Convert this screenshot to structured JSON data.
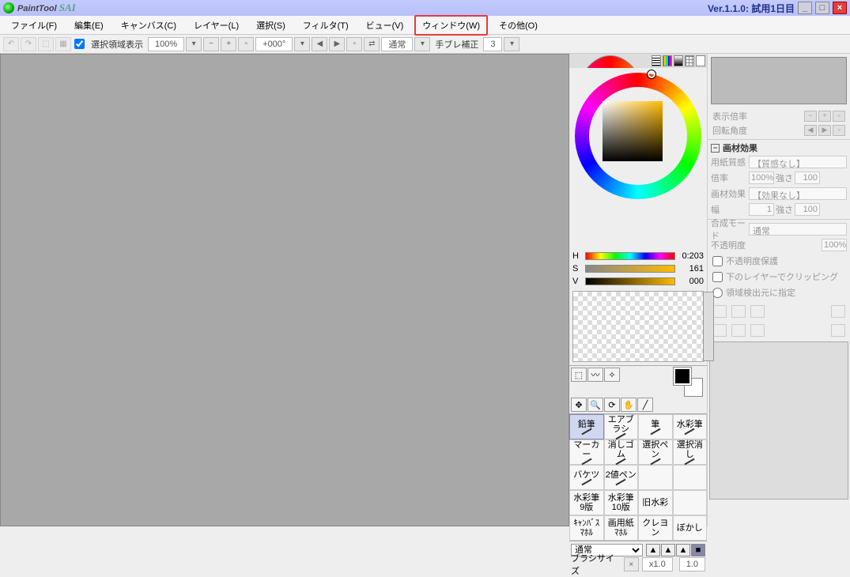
{
  "titlebar": {
    "app": "PaintTool",
    "sai": "SAI",
    "version": "Ver.1.1.0: 試用1日目"
  },
  "menu": {
    "file": "ファイル(F)",
    "edit": "編集(E)",
    "canvas": "キャンバス(C)",
    "layer": "レイヤー(L)",
    "select": "選択(S)",
    "filter": "フィルタ(T)",
    "view": "ビュー(V)",
    "window": "ウィンドウ(W)",
    "other": "その他(O)"
  },
  "toolbar": {
    "sel_show": "選択領域表示",
    "zoom": "100%",
    "angle": "+000°",
    "mode": "通常",
    "stabilizer_lbl": "手ブレ補正",
    "stabilizer_val": "3"
  },
  "hsv": {
    "h_lbl": "H",
    "h_val": "0:203",
    "s_lbl": "S",
    "s_val": "161",
    "v_lbl": "V",
    "v_val": "000"
  },
  "brushes": [
    "鉛筆",
    "エアブラシ",
    "筆",
    "水彩筆",
    "マーカー",
    "消しゴム",
    "選択ペン",
    "選択消し",
    "バケツ",
    "2値ペン",
    "",
    "",
    "水彩筆 9版",
    "水彩筆 10版",
    "旧水彩",
    "",
    "ｷｬﾝﾊﾞｽ ﾏﾎﾙ",
    "画用紙 ﾏﾎﾙ",
    "クレヨン",
    "ぼかし"
  ],
  "brush_ctrl": {
    "mode": "通常",
    "size_lbl": "ブラシサイズ",
    "size_mult": "x1.0",
    "size_val": "1.0"
  },
  "nav": {
    "zoom_lbl": "表示倍率",
    "rot_lbl": "回転角度"
  },
  "material": {
    "hdr": "画材効果",
    "paper_lbl": "用紙質感",
    "paper_val": "【質感なし】",
    "scale_lbl": "倍率",
    "scale_val": "100%",
    "scale_str_lbl": "強さ",
    "scale_str": "100",
    "effect_lbl": "画材効果",
    "effect_val": "【効果なし】",
    "width_lbl": "幅",
    "width_val": "1",
    "width_str_lbl": "強さ",
    "width_str": "100"
  },
  "blend": {
    "mode_lbl": "合成モード",
    "mode_val": "通常",
    "opacity_lbl": "不透明度",
    "opacity_val": "100%",
    "lock_opacity": "不透明度保護",
    "clip": "下のレイヤーでクリッピング",
    "sel_source": "領域検出元に指定"
  }
}
